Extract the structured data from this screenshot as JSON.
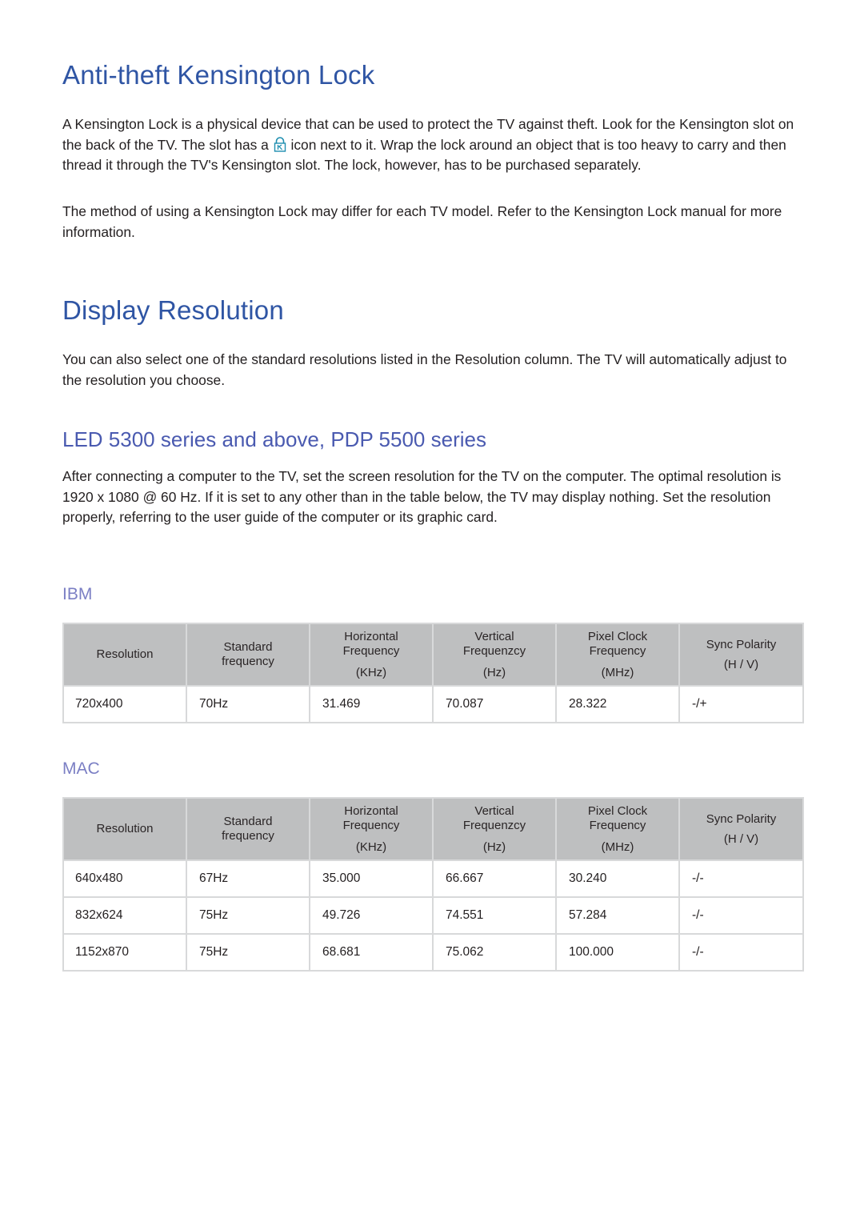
{
  "kensington": {
    "title": "Anti-theft Kensington Lock",
    "para1_part1": "A Kensington Lock is a physical device that can be used to protect the TV against theft. Look for the Kensington slot on the back of the TV. The slot has a ",
    "para1_icon": "kensington-lock-icon",
    "para1_part2": " icon next to it. Wrap the lock around an object that is too heavy to carry and then thread it through the TV's Kensington slot. The lock, however, has to be purchased separately.",
    "para2": "The method of using a Kensington Lock may differ for each TV model. Refer to the Kensington Lock manual for more information.",
    "icon_color": "#1f8fb0"
  },
  "display_resolution": {
    "title": "Display Resolution",
    "intro": "You can also select one of the standard resolutions listed in the Resolution column. The TV will automatically adjust to the resolution you choose.",
    "led_section": {
      "title": "LED 5300 series and above, PDP 5500 series",
      "body": "After connecting a computer to the TV, set the screen resolution for the TV on the computer. The optimal resolution is 1920 x 1080 @ 60 Hz. If it is set to any other than in the table below, the TV may display nothing. Set the resolution properly, referring to the user guide of the computer or its graphic card."
    }
  },
  "table_headers": {
    "resolution": "Resolution",
    "standard_line1": "Standard",
    "standard_line2": "frequency",
    "horizontal_line1": "Horizontal",
    "horizontal_line2": "Frequency",
    "horizontal_unit": "(KHz)",
    "vertical_line1": "Vertical",
    "vertical_line2": "Frequenzcy",
    "vertical_unit": "(Hz)",
    "pixel_line1": "Pixel Clock",
    "pixel_line2": "Frequency",
    "pixel_unit": "(MHz)",
    "sync_line1": "Sync Polarity",
    "sync_unit": "(H / V)"
  },
  "ibm": {
    "title": "IBM",
    "rows": [
      [
        "720x400",
        "70Hz",
        "31.469",
        "70.087",
        "28.322",
        "-/+"
      ]
    ]
  },
  "mac": {
    "title": "MAC",
    "rows": [
      [
        "640x480",
        "67Hz",
        "35.000",
        "66.667",
        "30.240",
        "-/-"
      ],
      [
        "832x624",
        "75Hz",
        "49.726",
        "74.551",
        "57.284",
        "-/-"
      ],
      [
        "1152x870",
        "75Hz",
        "68.681",
        "75.062",
        "100.000",
        "-/-"
      ]
    ]
  },
  "colors": {
    "heading_blue": "#2f55a4",
    "subheading_blue": "#4a5ab0",
    "section_label_purple": "#7b7fc4",
    "table_header_bg": "#bebfc0",
    "table_border": "#d8d9da",
    "body_text": "#231f20"
  }
}
